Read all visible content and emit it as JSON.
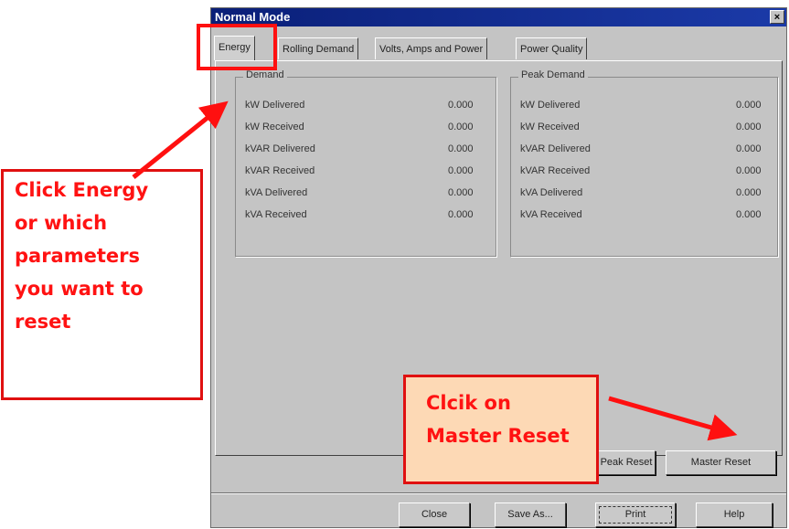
{
  "window": {
    "title": "Normal Mode",
    "close_glyph": "×"
  },
  "tabs": [
    "Energy",
    "Rolling Demand",
    "Volts, Amps and Power",
    "Power Quality"
  ],
  "demand": {
    "title": "Demand",
    "rows": [
      {
        "label": "kW Delivered",
        "value": "0.000"
      },
      {
        "label": "kW Received",
        "value": "0.000"
      },
      {
        "label": "kVAR Delivered",
        "value": "0.000"
      },
      {
        "label": "kVAR Received",
        "value": "0.000"
      },
      {
        "label": "kVA Delivered",
        "value": "0.000"
      },
      {
        "label": "kVA Received",
        "value": "0.000"
      }
    ]
  },
  "peak_demand": {
    "title": "Peak Demand",
    "rows": [
      {
        "label": "kW Delivered",
        "value": "0.000"
      },
      {
        "label": "kW Received",
        "value": "0.000"
      },
      {
        "label": "kVAR Delivered",
        "value": "0.000"
      },
      {
        "label": "kVAR Received",
        "value": "0.000"
      },
      {
        "label": "kVA Delivered",
        "value": "0.000"
      },
      {
        "label": "kVA Received",
        "value": "0.000"
      }
    ]
  },
  "reset_buttons": {
    "peak_reset": "Peak Reset",
    "master_reset": "Master Reset"
  },
  "footer_buttons": {
    "close": "Close",
    "save_as": "Save As...",
    "print": "Print",
    "help": "Help"
  },
  "annotations": {
    "left_callout": [
      "Click Energy",
      "or  which",
      "parameters",
      "you want to",
      "reset"
    ],
    "right_callout": [
      "Clcik on",
      "Master Reset"
    ],
    "annotation_color": "#ff1010"
  }
}
